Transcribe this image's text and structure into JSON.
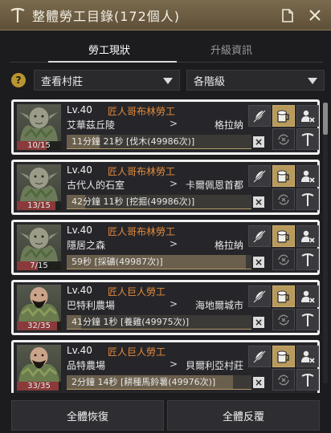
{
  "header": {
    "title": "整體勞工目錄(172個人)"
  },
  "tabs": [
    {
      "label": "勞工現狀",
      "active": true
    },
    {
      "label": "升級資訊",
      "active": false
    }
  ],
  "filters": {
    "help_label": "?",
    "village": "查看村莊",
    "grade": "各階級"
  },
  "workers": [
    {
      "level": "Lv.40",
      "name": "匠人哥布林勞工",
      "location": "艾華茲丘陵",
      "arrow": ">",
      "destination": "格拉納",
      "stamina": "10/15",
      "stamina_fraction": 0.67,
      "task": "11分鐘 21秒 [伐木(49986次)]",
      "task_progress": 0.18,
      "race": "goblin"
    },
    {
      "level": "Lv.40",
      "name": "匠人哥布林勞工",
      "location": "古代人的石室",
      "arrow": ">",
      "destination": "卡爾佩恩首都",
      "stamina": "13/15",
      "stamina_fraction": 0.87,
      "task": "42分鐘 11秒 [挖掘(49986次)]",
      "task_progress": 0.1,
      "race": "goblin"
    },
    {
      "level": "Lv.40",
      "name": "匠人哥布林勞工",
      "location": "隱居之森",
      "arrow": ">",
      "destination": "格拉納",
      "stamina": "7/15",
      "stamina_fraction": 0.47,
      "task": "59秒 [採礦(49987次)]",
      "task_progress": 0.97,
      "race": "goblin"
    },
    {
      "level": "Lv.40",
      "name": "匠人巨人勞工",
      "location": "巴特利農場",
      "arrow": ">",
      "destination": "海地爾城市",
      "stamina": "32/35",
      "stamina_fraction": 0.91,
      "task": "41分鐘 1秒 [養雞(49975次)]",
      "task_progress": 0.08,
      "race": "giant"
    },
    {
      "level": "Lv.40",
      "name": "匠人巨人勞工",
      "location": "品特農場",
      "arrow": ">",
      "destination": "貝爾利亞村莊",
      "stamina": "33/35",
      "stamina_fraction": 0.94,
      "task": "2分鐘 14秒 [耕種馬鈴薯(49976次)]",
      "task_progress": 0.9,
      "race": "giant"
    }
  ],
  "footer": {
    "recover_all": "全體恢復",
    "repeat_all": "全體反覆"
  },
  "colors": {
    "worker_name": "#e38a3c",
    "accent_gold": "#b89a5c",
    "titlebar": "#6e5f44"
  },
  "icons": {
    "title": "shovel-icon",
    "actions": [
      "memo-icon",
      "close-icon"
    ],
    "card_buttons": [
      "no-feather-icon",
      "beer-icon",
      "dismiss-worker-icon",
      "repeat-cancel-icon",
      "upgrade-shovel-icon"
    ]
  }
}
